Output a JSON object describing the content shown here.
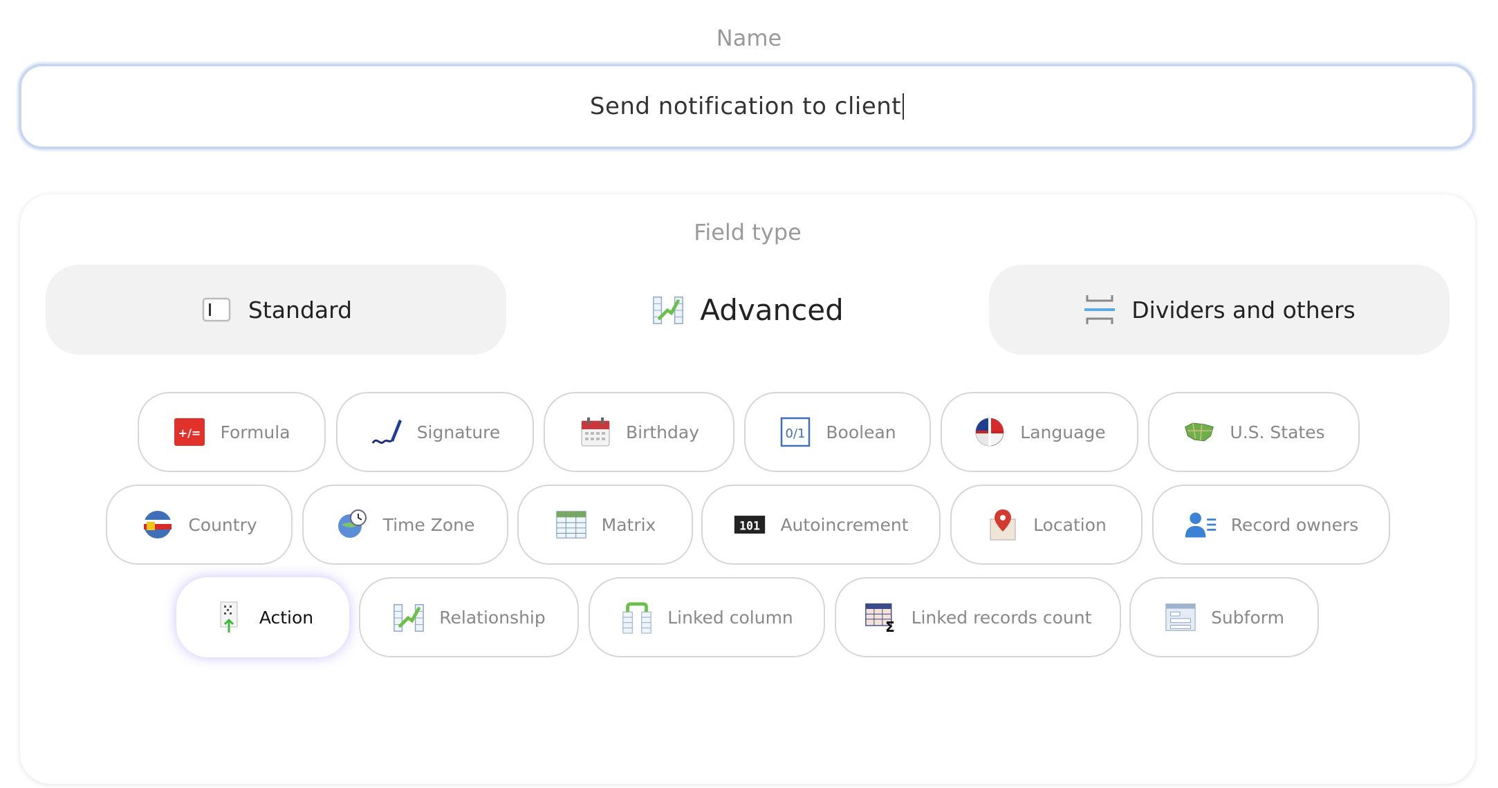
{
  "name_section": {
    "label": "Name",
    "input_value": "Send notification to client"
  },
  "field_type": {
    "label": "Field type",
    "tabs": [
      {
        "label": "Standard",
        "icon": "text-field-icon",
        "selected": false
      },
      {
        "label": "Advanced",
        "icon": "relationship-icon",
        "selected": true
      },
      {
        "label": "Dividers and others",
        "icon": "divider-icon",
        "selected": false
      }
    ],
    "types": [
      {
        "label": "Formula",
        "icon": "formula-icon"
      },
      {
        "label": "Signature",
        "icon": "signature-icon"
      },
      {
        "label": "Birthday",
        "icon": "calendar-icon"
      },
      {
        "label": "Boolean",
        "icon": "boolean-icon"
      },
      {
        "label": "Language",
        "icon": "flags-icon"
      },
      {
        "label": "U.S. States",
        "icon": "us-map-icon"
      },
      {
        "label": "Country",
        "icon": "globe-flag-icon"
      },
      {
        "label": "Time Zone",
        "icon": "globe-clock-icon"
      },
      {
        "label": "Matrix",
        "icon": "table-icon"
      },
      {
        "label": "Autoincrement",
        "icon": "counter-icon"
      },
      {
        "label": "Location",
        "icon": "map-pin-icon"
      },
      {
        "label": "Record owners",
        "icon": "user-list-icon"
      },
      {
        "label": "Action",
        "icon": "action-icon",
        "selected": true
      },
      {
        "label": "Relationship",
        "icon": "relationship-icon"
      },
      {
        "label": "Linked column",
        "icon": "linked-column-icon"
      },
      {
        "label": "Linked records count",
        "icon": "sum-table-icon"
      },
      {
        "label": "Subform",
        "icon": "subform-icon"
      }
    ]
  },
  "colors": {
    "accent_focus": "#c8d6f2",
    "selected_glow": "#8c78ff",
    "tab_background": "#f2f2f2"
  }
}
